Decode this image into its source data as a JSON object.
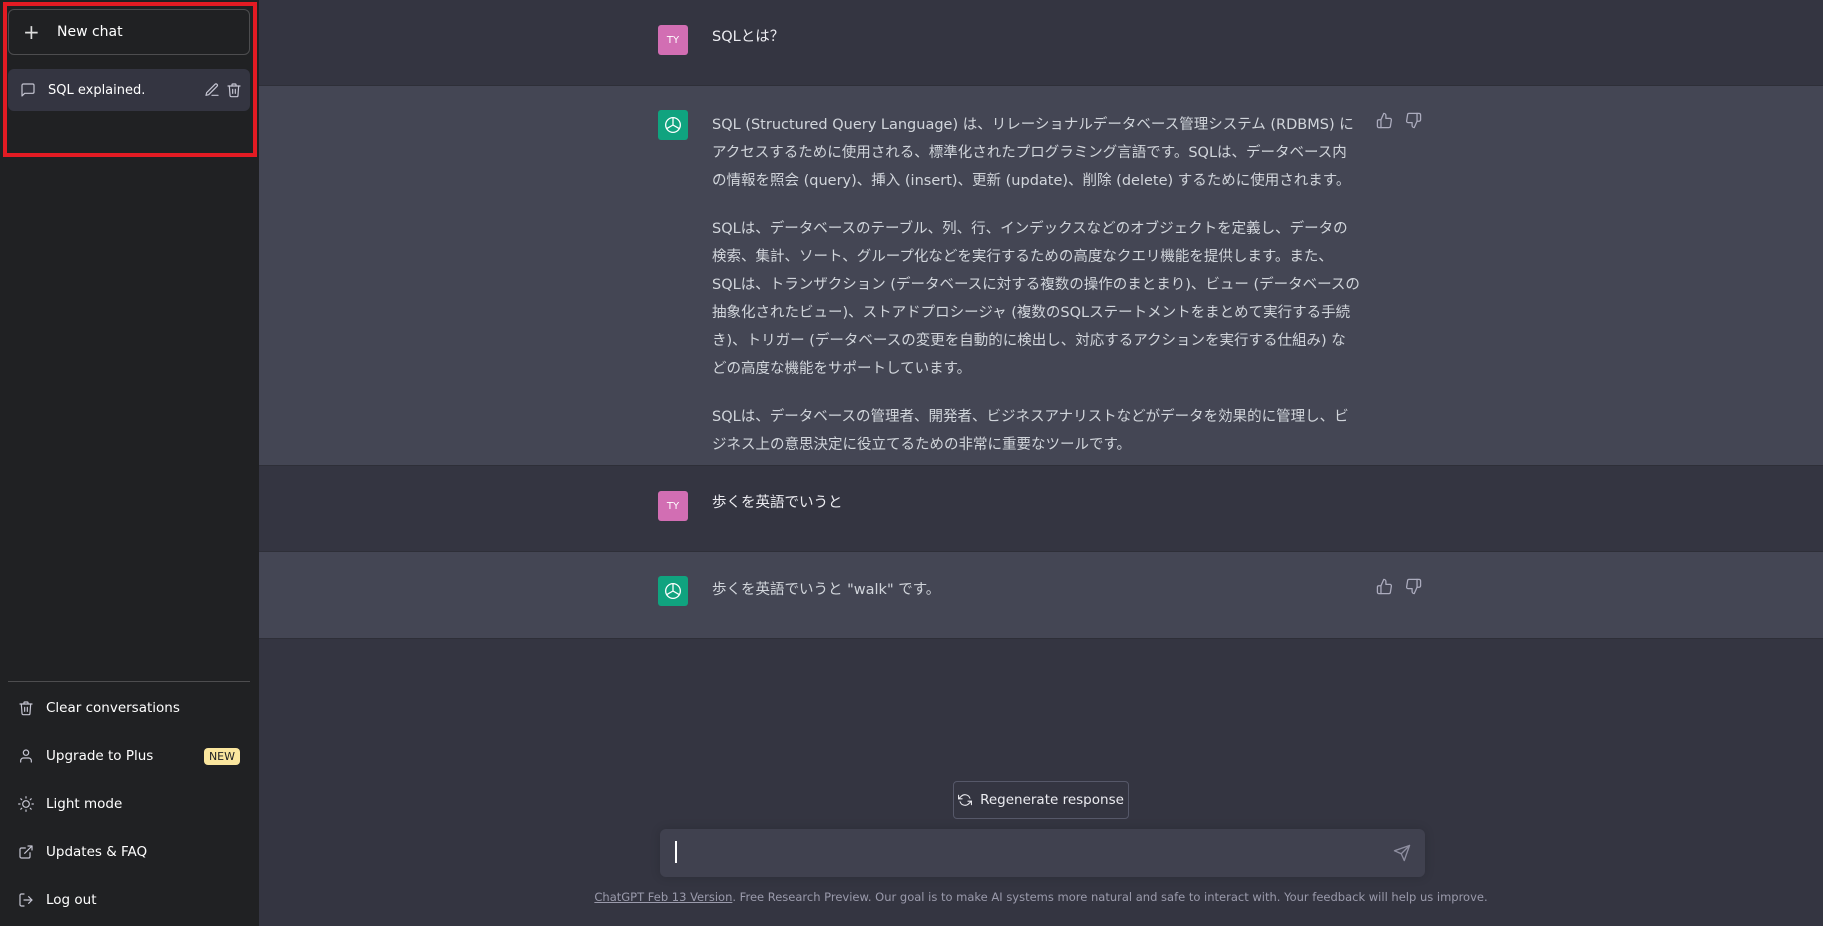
{
  "sidebar": {
    "new_chat_label": "New chat",
    "conversations": [
      {
        "title": "SQL explained."
      }
    ],
    "menu": [
      {
        "label": "Clear conversations",
        "icon": "trash-icon"
      },
      {
        "label": "Upgrade to Plus",
        "icon": "user-icon",
        "badge": "NEW"
      },
      {
        "label": "Light mode",
        "icon": "sun-icon"
      },
      {
        "label": "Updates & FAQ",
        "icon": "external-link-icon"
      },
      {
        "label": "Log out",
        "icon": "logout-icon"
      }
    ]
  },
  "messages": [
    {
      "role": "user",
      "avatar": "TY",
      "text": "SQLとは？"
    },
    {
      "role": "assistant",
      "paragraphs": [
        "SQL (Structured Query Language) は、リレーショナルデータベース管理システム (RDBMS) にアクセスするために使用される、標準化されたプログラミング言語です。SQLは、データベース内の情報を照会 (query)、挿入 (insert)、更新 (update)、削除 (delete) するために使用されます。",
        "SQLは、データベースのテーブル、列、行、インデックスなどのオブジェクトを定義し、データの検索、集計、ソート、グループ化などを実行するための高度なクエリ機能を提供します。また、SQLは、トランザクション (データベースに対する複数の操作のまとまり)、ビュー (データベースの抽象化されたビュー)、ストアドプロシージャ (複数のSQLステートメントをまとめて実行する手続き)、トリガー (データベースの変更を自動的に検出し、対応するアクションを実行する仕組み) などの高度な機能をサポートしています。",
        "SQLは、データベースの管理者、開発者、ビジネスアナリストなどがデータを効果的に管理し、ビジネス上の意思決定に役立てるための非常に重要なツールです。"
      ]
    },
    {
      "role": "user",
      "avatar": "TY",
      "text": "歩くを英語でいうと"
    },
    {
      "role": "assistant",
      "paragraphs": [
        "歩くを英語でいうと \"walk\" です。"
      ]
    }
  ],
  "regenerate_label": "Regenerate response",
  "input": {
    "value": "",
    "placeholder": ""
  },
  "footer": {
    "link_text": "ChatGPT Feb 13 Version",
    "text": ". Free Research Preview. Our goal is to make AI systems more natural and safe to interact with. Your feedback will help us improve."
  },
  "colors": {
    "sidebar_bg": "#202123",
    "main_bg": "#343541",
    "assistant_bg": "#444654",
    "accent": "#10a37f",
    "user_avatar": "#d26eb3",
    "highlight_border": "#e31b23"
  }
}
